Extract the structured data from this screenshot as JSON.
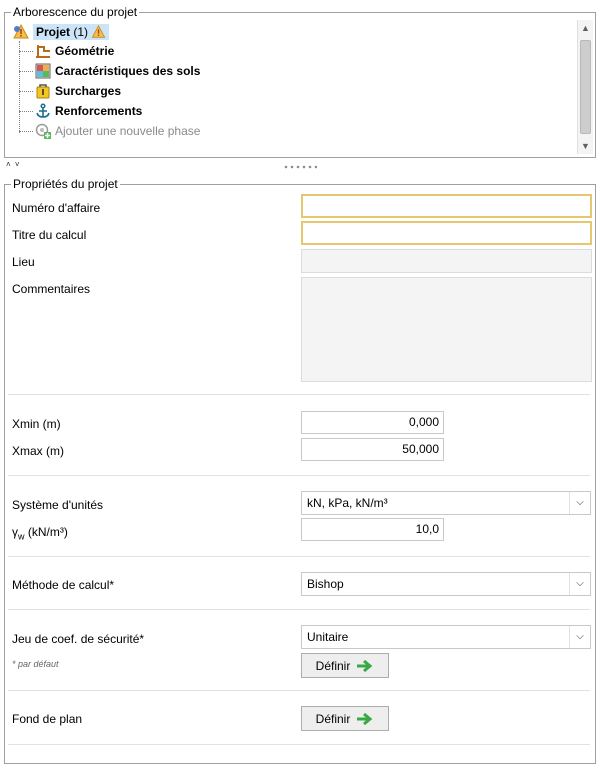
{
  "tree_group": {
    "title": "Arborescence du projet",
    "items": [
      {
        "label": "Projet",
        "suffix": "(1)",
        "icon": "warning-icon"
      },
      {
        "label": "Géométrie",
        "icon": "geometry-icon"
      },
      {
        "label": "Caractéristiques des sols",
        "icon": "soil-icon"
      },
      {
        "label": "Surcharges",
        "icon": "load-icon"
      },
      {
        "label": "Renforcements",
        "icon": "anchor-icon"
      },
      {
        "label": "Ajouter une nouvelle phase",
        "icon": "add-phase-icon"
      }
    ]
  },
  "splitter": {
    "arrows": "˄ ˅"
  },
  "props": {
    "title": "Propriétés du projet",
    "numero_label": "Numéro d'affaire",
    "numero_value": "",
    "titre_label": "Titre du calcul",
    "titre_value": "",
    "lieu_label": "Lieu",
    "lieu_value": "",
    "commentaires_label": "Commentaires",
    "commentaires_value": "",
    "xmin_label": "Xmin (m)",
    "xmin_value": "0,000",
    "xmax_label": "Xmax (m)",
    "xmax_value": "50,000",
    "unites_label": "Système d'unités",
    "unites_value": "kN, kPa, kN/m³",
    "gamma_label_sym": "γ",
    "gamma_label_sub": "w",
    "gamma_label_rest": " (kN/m³)",
    "gamma_value": "10,0",
    "methode_label": "Méthode de calcul*",
    "methode_value": "Bishop",
    "jeu_label": "Jeu de coef. de sécurité*",
    "jeu_value": "Unitaire",
    "definir_label": "Définir",
    "default_note": "* par défaut",
    "fond_label": "Fond de plan",
    "fond_button": "Définir"
  }
}
